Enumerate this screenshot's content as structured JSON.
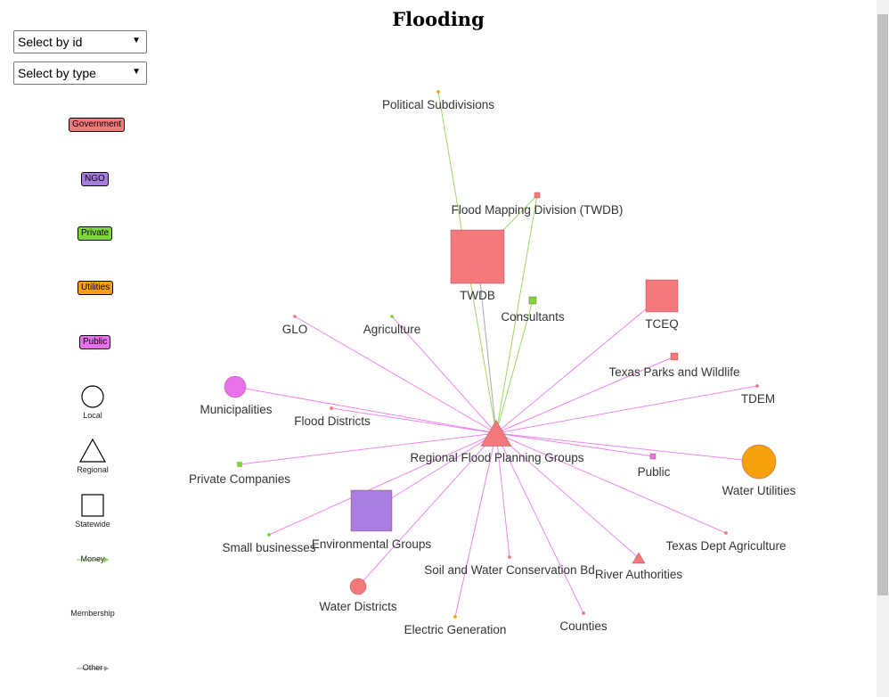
{
  "title": "Flooding",
  "controls": {
    "select_id_label": "Select by id",
    "select_type_label": "Select by type"
  },
  "legend": {
    "types": [
      {
        "label": "Government",
        "color": "#f4797b"
      },
      {
        "label": "NGO",
        "color": "#a87de0"
      },
      {
        "label": "Private",
        "color": "#7dd63b"
      },
      {
        "label": "Utilities",
        "color": "#f8a10d"
      },
      {
        "label": "Public",
        "color": "#e871ec"
      }
    ],
    "shapes": [
      {
        "label": "Local",
        "shape": "circle"
      },
      {
        "label": "Regional",
        "shape": "triangle"
      },
      {
        "label": "Statewide",
        "shape": "square"
      }
    ],
    "links": [
      {
        "label": "Money",
        "color": "#8bd34a"
      },
      {
        "label": "Membership",
        "color": "#e871ec"
      },
      {
        "label": "Other",
        "color": "#999999"
      }
    ]
  },
  "colors": {
    "Government": "#f4797b",
    "NGO": "#a87de0",
    "Private": "#7dd63b",
    "Utilities": "#f8a10d",
    "Public": "#e871ec",
    "money_link": "#8bd34a",
    "membership_link": "#e871ec",
    "other_link": "#999999"
  },
  "nodes": [
    {
      "id": "Regional Flood Planning Groups",
      "type": "Government",
      "shape": "triangle",
      "size": "large"
    },
    {
      "id": "Political Subdivisions",
      "type": "Utilities",
      "shape": "circle",
      "size": "tiny"
    },
    {
      "id": "Flood Mapping Division (TWDB)",
      "type": "Government",
      "shape": "square",
      "size": "small"
    },
    {
      "id": "TWDB",
      "type": "Government",
      "shape": "square",
      "size": "xlarge"
    },
    {
      "id": "Consultants",
      "type": "Private",
      "shape": "square",
      "size": "small"
    },
    {
      "id": "TCEQ",
      "type": "Government",
      "shape": "square",
      "size": "large"
    },
    {
      "id": "GLO",
      "type": "Government",
      "shape": "circle",
      "size": "tiny"
    },
    {
      "id": "Agriculture",
      "type": "Private",
      "shape": "circle",
      "size": "tiny"
    },
    {
      "id": "Texas Parks and Wildlife",
      "type": "Government",
      "shape": "square",
      "size": "small"
    },
    {
      "id": "TDEM",
      "type": "Government",
      "shape": "circle",
      "size": "tiny"
    },
    {
      "id": "Municipalities",
      "type": "Public",
      "shape": "circle",
      "size": "medium"
    },
    {
      "id": "Flood Districts",
      "type": "Government",
      "shape": "circle",
      "size": "tiny"
    },
    {
      "id": "Private Companies",
      "type": "Private",
      "shape": "square",
      "size": "tiny"
    },
    {
      "id": "Public",
      "type": "Public",
      "shape": "square",
      "size": "small"
    },
    {
      "id": "Water Utilities",
      "type": "Utilities",
      "shape": "circle",
      "size": "large"
    },
    {
      "id": "Environmental Groups",
      "type": "NGO",
      "shape": "square",
      "size": "xlarge"
    },
    {
      "id": "Small businesses",
      "type": "Private",
      "shape": "circle",
      "size": "tiny"
    },
    {
      "id": "Texas Dept Agriculture",
      "type": "Government",
      "shape": "circle",
      "size": "tiny"
    },
    {
      "id": "Soil and Water Conservation Bd",
      "type": "Government",
      "shape": "circle",
      "size": "tiny"
    },
    {
      "id": "River Authorities",
      "type": "Government",
      "shape": "triangle",
      "size": "small"
    },
    {
      "id": "Water Districts",
      "type": "Government",
      "shape": "circle",
      "size": "small"
    },
    {
      "id": "Electric Generation",
      "type": "Utilities",
      "shape": "circle",
      "size": "tiny"
    },
    {
      "id": "Counties",
      "type": "Government",
      "shape": "circle",
      "size": "tiny"
    }
  ],
  "links": [
    {
      "source": "Political Subdivisions",
      "target": "Regional Flood Planning Groups",
      "kind": "money"
    },
    {
      "source": "Flood Mapping Division (TWDB)",
      "target": "TWDB",
      "kind": "money"
    },
    {
      "source": "Flood Mapping Division (TWDB)",
      "target": "Regional Flood Planning Groups",
      "kind": "money"
    },
    {
      "source": "TWDB",
      "target": "Regional Flood Planning Groups",
      "kind": "other"
    },
    {
      "source": "Consultants",
      "target": "Regional Flood Planning Groups",
      "kind": "money"
    },
    {
      "source": "TCEQ",
      "target": "Regional Flood Planning Groups",
      "kind": "membership"
    },
    {
      "source": "GLO",
      "target": "Regional Flood Planning Groups",
      "kind": "membership"
    },
    {
      "source": "Agriculture",
      "target": "Regional Flood Planning Groups",
      "kind": "membership"
    },
    {
      "source": "Texas Parks and Wildlife",
      "target": "Regional Flood Planning Groups",
      "kind": "membership"
    },
    {
      "source": "TDEM",
      "target": "Regional Flood Planning Groups",
      "kind": "membership"
    },
    {
      "source": "Municipalities",
      "target": "Regional Flood Planning Groups",
      "kind": "membership"
    },
    {
      "source": "Flood Districts",
      "target": "Regional Flood Planning Groups",
      "kind": "membership"
    },
    {
      "source": "Private Companies",
      "target": "Regional Flood Planning Groups",
      "kind": "membership"
    },
    {
      "source": "Public",
      "target": "Regional Flood Planning Groups",
      "kind": "membership"
    },
    {
      "source": "Water Utilities",
      "target": "Regional Flood Planning Groups",
      "kind": "membership"
    },
    {
      "source": "Environmental Groups",
      "target": "Regional Flood Planning Groups",
      "kind": "membership"
    },
    {
      "source": "Small businesses",
      "target": "Regional Flood Planning Groups",
      "kind": "membership"
    },
    {
      "source": "Texas Dept Agriculture",
      "target": "Regional Flood Planning Groups",
      "kind": "membership"
    },
    {
      "source": "Soil and Water Conservation Bd",
      "target": "Regional Flood Planning Groups",
      "kind": "membership"
    },
    {
      "source": "River Authorities",
      "target": "Regional Flood Planning Groups",
      "kind": "membership"
    },
    {
      "source": "Water Districts",
      "target": "Regional Flood Planning Groups",
      "kind": "membership"
    },
    {
      "source": "Electric Generation",
      "target": "Regional Flood Planning Groups",
      "kind": "membership"
    },
    {
      "source": "Counties",
      "target": "Regional Flood Planning Groups",
      "kind": "membership"
    }
  ]
}
